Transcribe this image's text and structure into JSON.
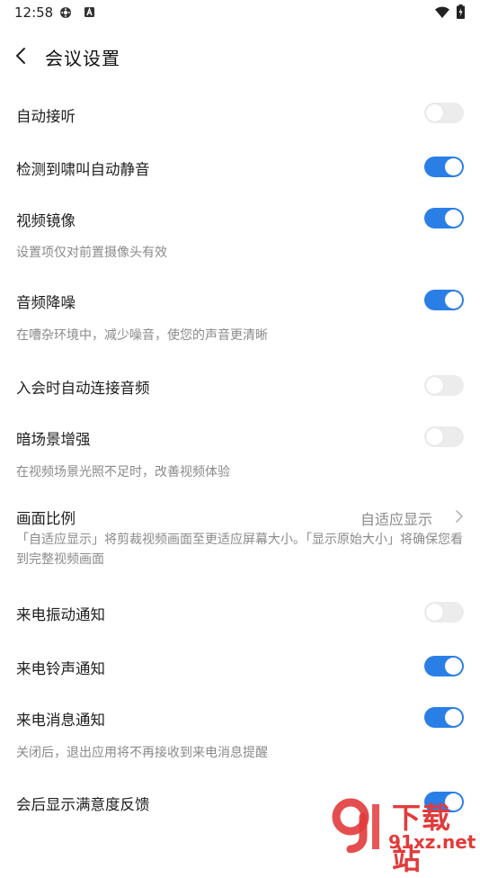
{
  "status_bar": {
    "time": "12:58",
    "icons": [
      "settings-sync-icon",
      "a-badge-icon",
      "wifi-icon",
      "battery-charging-icon"
    ]
  },
  "header": {
    "title": "会议设置",
    "back_icon": "back-arrow-icon"
  },
  "settings": {
    "auto_answer": {
      "label": "自动接听",
      "enabled": false
    },
    "howl_mute": {
      "label": "检测到啸叫自动静音",
      "enabled": true
    },
    "video_mirror": {
      "label": "视频镜像",
      "enabled": true,
      "desc": "设置项仅对前置摄像头有效"
    },
    "audio_denoise": {
      "label": "音频降噪",
      "enabled": true,
      "desc": "在嘈杂环境中，减少噪音，使您的声音更清晰"
    },
    "auto_connect_audio": {
      "label": "入会时自动连接音频",
      "enabled": false
    },
    "dark_scene": {
      "label": "暗场景增强",
      "enabled": false,
      "desc": "在视频场景光照不足时，改善视频体验"
    },
    "aspect_ratio": {
      "label": "画面比例",
      "value": "自适应显示",
      "desc": "「自适应显示」将剪裁视频画面至更适应屏幕大小。「显示原始大小」将确保您看到完整视频画面"
    },
    "call_vibrate": {
      "label": "来电振动通知",
      "enabled": false
    },
    "call_ringtone": {
      "label": "来电铃声通知",
      "enabled": true
    },
    "call_message": {
      "label": "来电消息通知",
      "enabled": true,
      "desc": "关闭后，退出应用将不再接收到来电消息提醒"
    },
    "satisfaction_feedback": {
      "label": "会后显示满意度反馈",
      "enabled": true
    }
  },
  "watermark": {
    "top": "下载站",
    "bottom": "91xz.net"
  },
  "colors": {
    "accent": "#2a7fe6",
    "toggle_off": "#ececec",
    "secondary_text": "#8a8a8a",
    "watermark": "#e23b3b"
  }
}
